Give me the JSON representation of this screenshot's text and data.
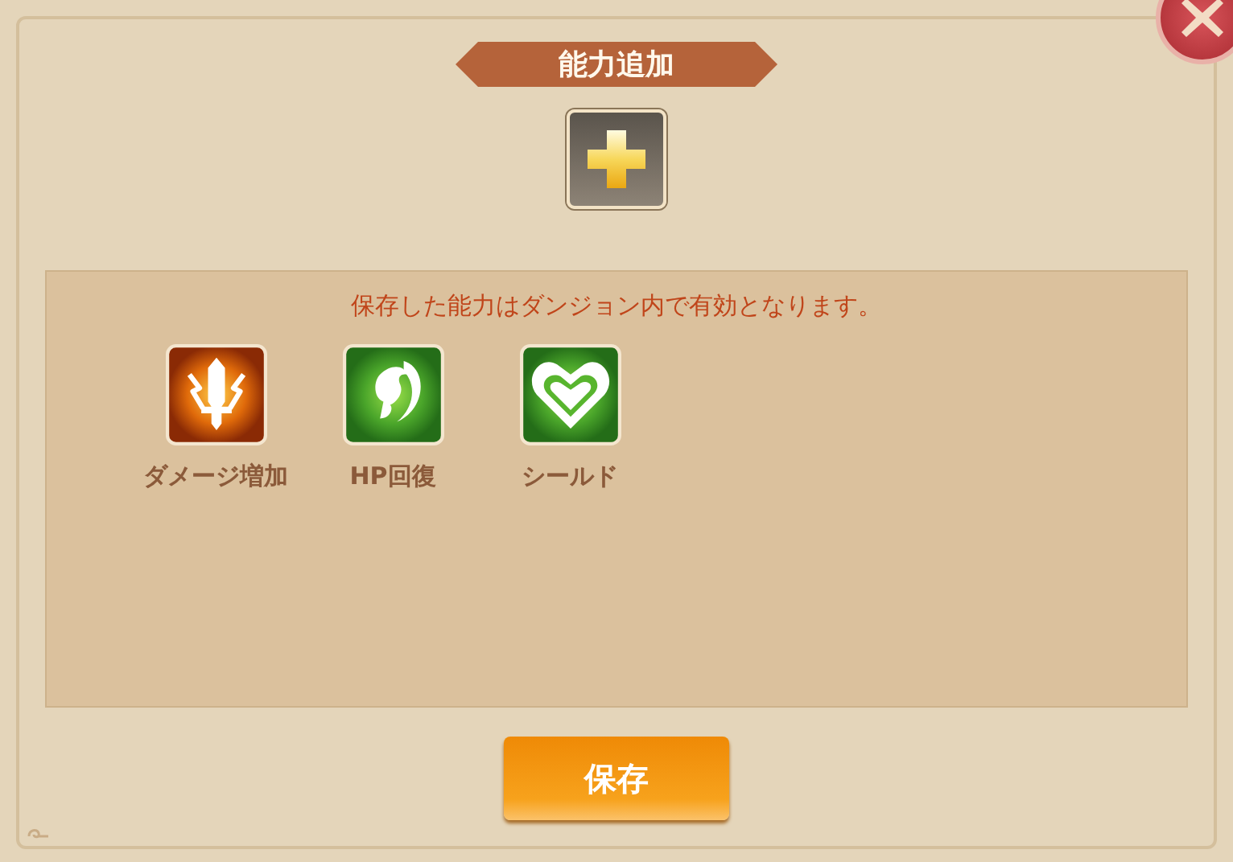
{
  "dialog": {
    "title": "能力追加"
  },
  "message": "保存した能力はダンジョン内で有効となります。",
  "abilities": [
    {
      "kind": "damage",
      "label": "ダメージ増加"
    },
    {
      "kind": "heal",
      "label": "HP回復"
    },
    {
      "kind": "shield",
      "label": "シールド"
    }
  ],
  "buttons": [
    "保存"
  ]
}
